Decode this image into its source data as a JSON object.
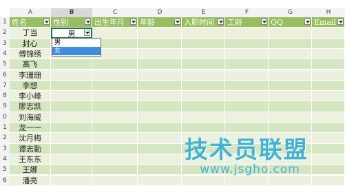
{
  "columns": [
    "A",
    "B",
    "C",
    "D",
    "E",
    "F",
    "G",
    "H"
  ],
  "rows": [
    "1",
    "2",
    "3",
    "4",
    "5",
    "6",
    "7",
    "8",
    "9",
    "0",
    "1",
    "2",
    "3",
    "4",
    "5",
    "6"
  ],
  "headers": [
    "姓名",
    "性别",
    "出生年月",
    "年龄",
    "入职时间",
    "工龄",
    "QQ",
    "Email"
  ],
  "active_value": "男",
  "names": [
    "丁当",
    "封心",
    "傅锦绣",
    "高飞",
    "李珊珊",
    "李想",
    "李小峰",
    "廖志凯",
    "刘海威",
    "龙一一",
    "沈月梅",
    "谭志勤",
    "王东东",
    "王娜",
    "潘亮"
  ],
  "dropdown": {
    "options": [
      "男",
      "女"
    ],
    "selected_index": 1
  },
  "watermark": {
    "title": "技术员联盟",
    "url": "www.jsgho.com"
  },
  "colors": {
    "header_green": "#97bf5c",
    "band_light": "#ebf1de",
    "band_dark": "#d6e6c0",
    "select_blue": "#3b8ee6"
  }
}
